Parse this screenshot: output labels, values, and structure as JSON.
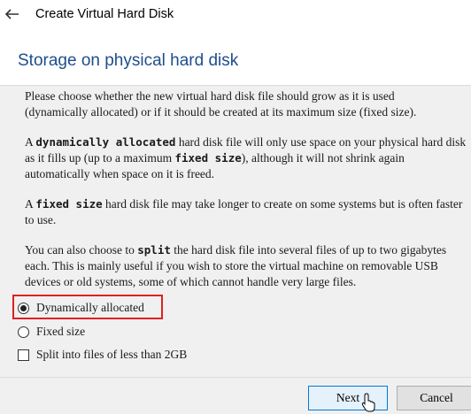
{
  "window": {
    "title": "Create Virtual Hard Disk"
  },
  "page": {
    "title": "Storage on physical hard disk"
  },
  "paragraphs": {
    "p1_line1": "Please choose whether the new virtual hard disk file should grow as it is used",
    "p1_line2": "(dynamically allocated) or if it should be created at its maximum size (fixed size).",
    "p2_a": "A ",
    "p2_bold1": "dynamically allocated",
    "p2_b": " hard disk file will only use space on your physical hard disk",
    "p2_line2a": "as it fills up (up to a maximum ",
    "p2_bold2": "fixed size",
    "p2_line2b": "), although it will not shrink again",
    "p2_line3": "automatically when space on it is freed.",
    "p3_a": "A ",
    "p3_bold": "fixed size",
    "p3_b": " hard disk file may take longer to create on some systems but is often faster",
    "p3_line2": "to use.",
    "p4_a": "You can also choose to ",
    "p4_bold": "split",
    "p4_b": " the hard disk file into several files of up to two gigabytes",
    "p4_line2": "each. This is mainly useful if you wish to store the virtual machine on removable USB",
    "p4_line3": "devices or old systems, some of which cannot handle very large files."
  },
  "options": {
    "dynamic": {
      "label": "Dynamically allocated",
      "checked": true
    },
    "fixed": {
      "label": "Fixed size",
      "checked": false
    },
    "split": {
      "label": "Split into files of less than 2GB",
      "checked": false
    }
  },
  "buttons": {
    "next": "Next",
    "cancel": "Cancel"
  },
  "colors": {
    "title_blue": "#1f4e8c",
    "highlight_red": "#e02020"
  },
  "icons": {
    "back": "arrow-left-icon",
    "cursor": "mouse-pointer-icon"
  }
}
